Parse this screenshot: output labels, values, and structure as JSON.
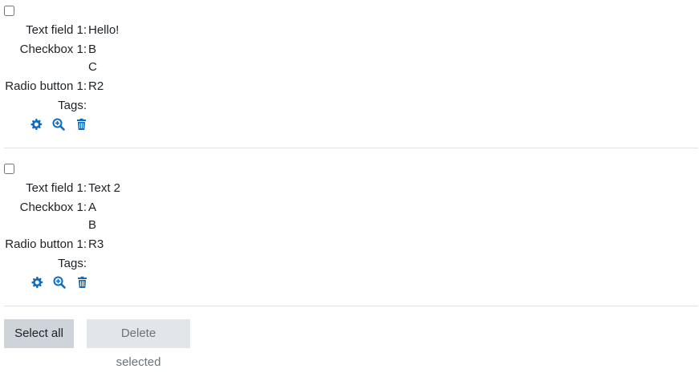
{
  "colors": {
    "icon": "#0f6cbf",
    "divider": "#dee2e6",
    "select_all_bg": "#ced4da",
    "delete_bg": "#e2e5e9"
  },
  "entries": [
    {
      "fields": {
        "text_field_label": "Text field 1:",
        "text_field_value": "Hello!",
        "checkbox_label": "Checkbox 1:",
        "checkbox_values": [
          "B",
          "C"
        ],
        "radio_label": "Radio button 1:",
        "radio_value": "R2",
        "tags_label": "Tags:"
      },
      "actions": [
        "gear-icon",
        "zoom-in-icon",
        "trash-icon"
      ]
    },
    {
      "fields": {
        "text_field_label": "Text field 1:",
        "text_field_value": "Text 2",
        "checkbox_label": "Checkbox 1:",
        "checkbox_values": [
          "A",
          "B"
        ],
        "radio_label": "Radio button 1:",
        "radio_value": "R3",
        "tags_label": "Tags:"
      },
      "actions": [
        "gear-icon",
        "zoom-in-icon",
        "trash-icon"
      ]
    }
  ],
  "buttons": {
    "select_all": "Select all",
    "delete_selected": "Delete selected"
  }
}
